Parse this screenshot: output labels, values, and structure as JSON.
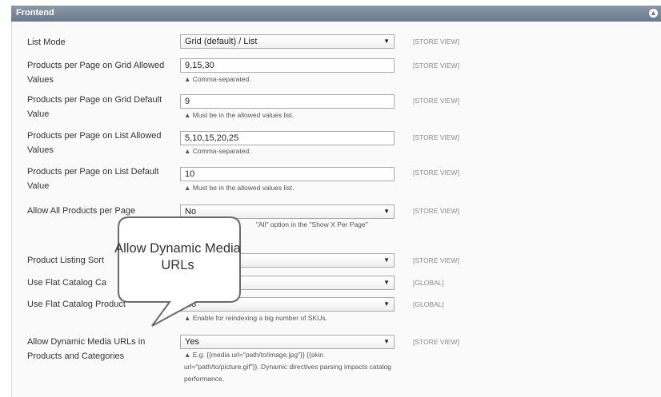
{
  "header": {
    "title": "Frontend",
    "collapse_icon": "circle-up-icon"
  },
  "rows": [
    {
      "label": "List Mode",
      "value": "Grid (default) / List",
      "type": "select",
      "note": "",
      "scope": "[STORE VIEW]"
    },
    {
      "label": "Products per Page on Grid Allowed Values",
      "value": "9,15,30",
      "type": "text",
      "note": "▲ Comma-separated.",
      "scope": "[STORE VIEW]"
    },
    {
      "label": "Products per Page on Grid Default Value",
      "value": "9",
      "type": "text",
      "note": "▲ Must be in the allowed values list.",
      "scope": "[STORE VIEW]"
    },
    {
      "label": "Products per Page on List Allowed Values",
      "value": "5,10,15,20,25",
      "type": "text",
      "note": "▲ Comma-separated.",
      "scope": "[STORE VIEW]"
    },
    {
      "label": "Products per Page on List Default Value",
      "value": "10",
      "type": "text",
      "note": "▲ Must be in the allowed values list.",
      "scope": "[STORE VIEW]"
    },
    {
      "label": "Allow All Products per Page",
      "value": "No",
      "type": "select",
      "note": "\"All\" option in the \"Show X Per Page\"",
      "scope": "[STORE VIEW]"
    },
    {
      "label": "Product Listing Sort",
      "value": "",
      "type": "select",
      "note": "",
      "scope": "[STORE VIEW]"
    },
    {
      "label": "Use Flat Catalog Ca",
      "value": "",
      "type": "select",
      "note": "",
      "scope": "[GLOBAL]"
    },
    {
      "label": "Use Flat Catalog Product",
      "value": "No",
      "type": "select",
      "note": "▲ Enable for reindexing a big number of SKUs.",
      "scope": "[GLOBAL]"
    },
    {
      "label": "Allow Dynamic Media URLs in Products and Categories",
      "value": "Yes",
      "type": "select",
      "note": "▲ E.g. {{media url=\"path/to/image.jpg\"}} {{skin url=\"path/to/picture.gif\"}}. Dynamic directives parsing impacts catalog performance.",
      "scope": "[STORE VIEW]"
    }
  ],
  "callout": {
    "text": "Allow Dynamic Media URLs"
  },
  "colors": {
    "header": "#7a8898",
    "callout_border": "#6a6a6a"
  }
}
